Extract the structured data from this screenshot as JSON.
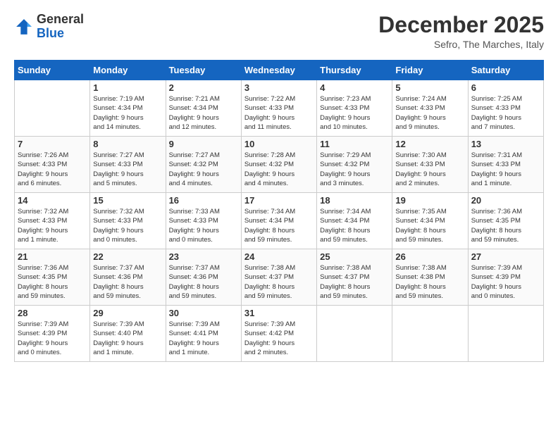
{
  "header": {
    "logo": {
      "general": "General",
      "blue": "Blue"
    },
    "title": "December 2025",
    "location": "Sefro, The Marches, Italy"
  },
  "calendar": {
    "days_of_week": [
      "Sunday",
      "Monday",
      "Tuesday",
      "Wednesday",
      "Thursday",
      "Friday",
      "Saturday"
    ],
    "weeks": [
      [
        {
          "day": "",
          "info": ""
        },
        {
          "day": "1",
          "info": "Sunrise: 7:19 AM\nSunset: 4:34 PM\nDaylight: 9 hours\nand 14 minutes."
        },
        {
          "day": "2",
          "info": "Sunrise: 7:21 AM\nSunset: 4:34 PM\nDaylight: 9 hours\nand 12 minutes."
        },
        {
          "day": "3",
          "info": "Sunrise: 7:22 AM\nSunset: 4:33 PM\nDaylight: 9 hours\nand 11 minutes."
        },
        {
          "day": "4",
          "info": "Sunrise: 7:23 AM\nSunset: 4:33 PM\nDaylight: 9 hours\nand 10 minutes."
        },
        {
          "day": "5",
          "info": "Sunrise: 7:24 AM\nSunset: 4:33 PM\nDaylight: 9 hours\nand 9 minutes."
        },
        {
          "day": "6",
          "info": "Sunrise: 7:25 AM\nSunset: 4:33 PM\nDaylight: 9 hours\nand 7 minutes."
        }
      ],
      [
        {
          "day": "7",
          "info": "Sunrise: 7:26 AM\nSunset: 4:33 PM\nDaylight: 9 hours\nand 6 minutes."
        },
        {
          "day": "8",
          "info": "Sunrise: 7:27 AM\nSunset: 4:33 PM\nDaylight: 9 hours\nand 5 minutes."
        },
        {
          "day": "9",
          "info": "Sunrise: 7:27 AM\nSunset: 4:32 PM\nDaylight: 9 hours\nand 4 minutes."
        },
        {
          "day": "10",
          "info": "Sunrise: 7:28 AM\nSunset: 4:32 PM\nDaylight: 9 hours\nand 4 minutes."
        },
        {
          "day": "11",
          "info": "Sunrise: 7:29 AM\nSunset: 4:32 PM\nDaylight: 9 hours\nand 3 minutes."
        },
        {
          "day": "12",
          "info": "Sunrise: 7:30 AM\nSunset: 4:33 PM\nDaylight: 9 hours\nand 2 minutes."
        },
        {
          "day": "13",
          "info": "Sunrise: 7:31 AM\nSunset: 4:33 PM\nDaylight: 9 hours\nand 1 minute."
        }
      ],
      [
        {
          "day": "14",
          "info": "Sunrise: 7:32 AM\nSunset: 4:33 PM\nDaylight: 9 hours\nand 1 minute."
        },
        {
          "day": "15",
          "info": "Sunrise: 7:32 AM\nSunset: 4:33 PM\nDaylight: 9 hours\nand 0 minutes."
        },
        {
          "day": "16",
          "info": "Sunrise: 7:33 AM\nSunset: 4:33 PM\nDaylight: 9 hours\nand 0 minutes."
        },
        {
          "day": "17",
          "info": "Sunrise: 7:34 AM\nSunset: 4:34 PM\nDaylight: 8 hours\nand 59 minutes."
        },
        {
          "day": "18",
          "info": "Sunrise: 7:34 AM\nSunset: 4:34 PM\nDaylight: 8 hours\nand 59 minutes."
        },
        {
          "day": "19",
          "info": "Sunrise: 7:35 AM\nSunset: 4:34 PM\nDaylight: 8 hours\nand 59 minutes."
        },
        {
          "day": "20",
          "info": "Sunrise: 7:36 AM\nSunset: 4:35 PM\nDaylight: 8 hours\nand 59 minutes."
        }
      ],
      [
        {
          "day": "21",
          "info": "Sunrise: 7:36 AM\nSunset: 4:35 PM\nDaylight: 8 hours\nand 59 minutes."
        },
        {
          "day": "22",
          "info": "Sunrise: 7:37 AM\nSunset: 4:36 PM\nDaylight: 8 hours\nand 59 minutes."
        },
        {
          "day": "23",
          "info": "Sunrise: 7:37 AM\nSunset: 4:36 PM\nDaylight: 8 hours\nand 59 minutes."
        },
        {
          "day": "24",
          "info": "Sunrise: 7:38 AM\nSunset: 4:37 PM\nDaylight: 8 hours\nand 59 minutes."
        },
        {
          "day": "25",
          "info": "Sunrise: 7:38 AM\nSunset: 4:37 PM\nDaylight: 8 hours\nand 59 minutes."
        },
        {
          "day": "26",
          "info": "Sunrise: 7:38 AM\nSunset: 4:38 PM\nDaylight: 8 hours\nand 59 minutes."
        },
        {
          "day": "27",
          "info": "Sunrise: 7:39 AM\nSunset: 4:39 PM\nDaylight: 9 hours\nand 0 minutes."
        }
      ],
      [
        {
          "day": "28",
          "info": "Sunrise: 7:39 AM\nSunset: 4:39 PM\nDaylight: 9 hours\nand 0 minutes."
        },
        {
          "day": "29",
          "info": "Sunrise: 7:39 AM\nSunset: 4:40 PM\nDaylight: 9 hours\nand 1 minute."
        },
        {
          "day": "30",
          "info": "Sunrise: 7:39 AM\nSunset: 4:41 PM\nDaylight: 9 hours\nand 1 minute."
        },
        {
          "day": "31",
          "info": "Sunrise: 7:39 AM\nSunset: 4:42 PM\nDaylight: 9 hours\nand 2 minutes."
        },
        {
          "day": "",
          "info": ""
        },
        {
          "day": "",
          "info": ""
        },
        {
          "day": "",
          "info": ""
        }
      ]
    ]
  }
}
